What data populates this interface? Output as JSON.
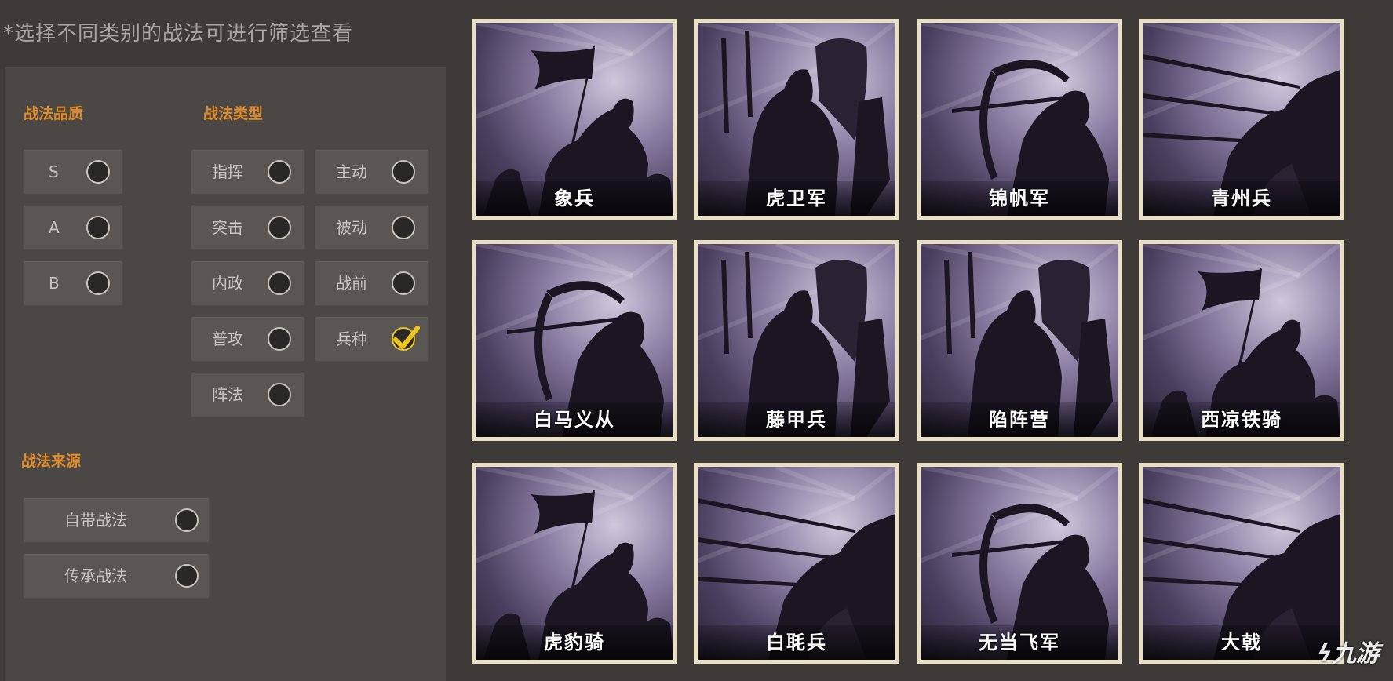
{
  "hint": "*选择不同类别的战法可进行筛选查看",
  "quality": {
    "title": "战法品质",
    "options": [
      {
        "label": "S",
        "checked": false
      },
      {
        "label": "A",
        "checked": false
      },
      {
        "label": "B",
        "checked": false
      }
    ]
  },
  "type": {
    "title": "战法类型",
    "options": [
      {
        "label": "指挥",
        "checked": false
      },
      {
        "label": "主动",
        "checked": false
      },
      {
        "label": "突击",
        "checked": false
      },
      {
        "label": "被动",
        "checked": false
      },
      {
        "label": "内政",
        "checked": false
      },
      {
        "label": "战前",
        "checked": false
      },
      {
        "label": "普攻",
        "checked": false
      },
      {
        "label": "兵种",
        "checked": true
      },
      {
        "label": "阵法",
        "checked": false
      }
    ]
  },
  "source": {
    "title": "战法来源",
    "options": [
      {
        "label": "自带战法",
        "checked": false
      },
      {
        "label": "传承战法",
        "checked": false
      }
    ]
  },
  "cards": [
    {
      "name": "象兵",
      "art": "banner-rider"
    },
    {
      "name": "虎卫军",
      "art": "shield-guard"
    },
    {
      "name": "锦帆军",
      "art": "archer"
    },
    {
      "name": "青州兵",
      "art": "spear-cavalry"
    },
    {
      "name": "白马义从",
      "art": "archer"
    },
    {
      "name": "藤甲兵",
      "art": "shield-guard"
    },
    {
      "name": "陷阵营",
      "art": "shield-guard"
    },
    {
      "name": "西凉铁骑",
      "art": "banner-rider"
    },
    {
      "name": "虎豹骑",
      "art": "banner-rider"
    },
    {
      "name": "白毦兵",
      "art": "spear-cavalry"
    },
    {
      "name": "无当飞军",
      "art": "archer"
    },
    {
      "name": "大戟",
      "art": "spear-cavalry"
    }
  ],
  "watermark": "九游",
  "colors": {
    "section_title": "#e08a2a",
    "check": "#ecc51d",
    "card_border": "#e9dfc3"
  }
}
